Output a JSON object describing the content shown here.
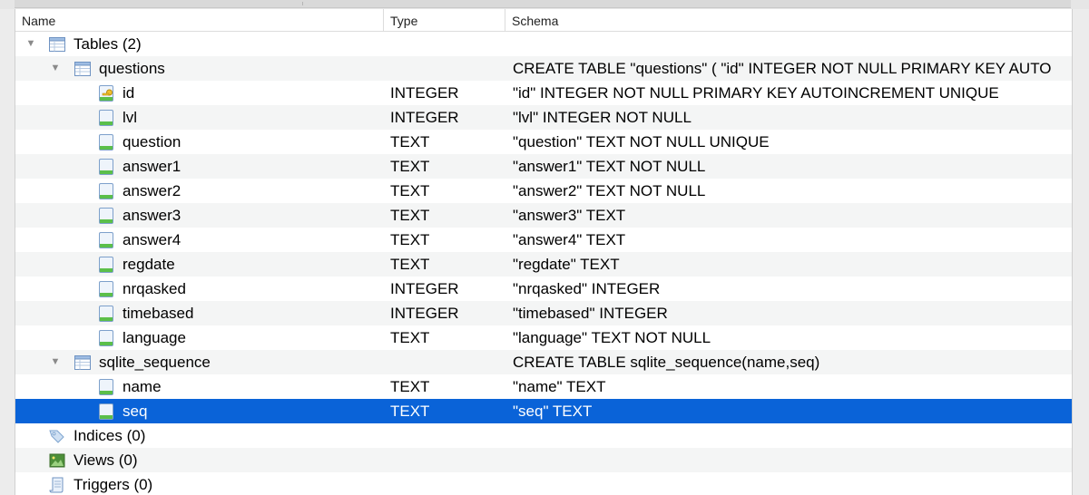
{
  "columns": {
    "name": "Name",
    "type": "Type",
    "schema": "Schema"
  },
  "rows": [
    {
      "label": "Tables (2)",
      "type": "",
      "schema": "",
      "level": 0,
      "icon": "table-group-icon",
      "disclosure": true
    },
    {
      "label": "questions",
      "type": "",
      "schema": "CREATE TABLE \"questions\" ( \"id\" INTEGER NOT NULL PRIMARY KEY AUTO",
      "level": 1,
      "icon": "table-icon",
      "disclosure": true
    },
    {
      "label": "id",
      "type": "INTEGER",
      "schema": "\"id\" INTEGER NOT NULL PRIMARY KEY AUTOINCREMENT UNIQUE",
      "level": 2,
      "icon": "primary-key-field-icon"
    },
    {
      "label": "lvl",
      "type": "INTEGER",
      "schema": "\"lvl\" INTEGER NOT NULL",
      "level": 2,
      "icon": "field-icon"
    },
    {
      "label": "question",
      "type": "TEXT",
      "schema": "\"question\" TEXT NOT NULL UNIQUE",
      "level": 2,
      "icon": "field-icon"
    },
    {
      "label": "answer1",
      "type": "TEXT",
      "schema": "\"answer1\" TEXT NOT NULL",
      "level": 2,
      "icon": "field-icon"
    },
    {
      "label": "answer2",
      "type": "TEXT",
      "schema": "\"answer2\" TEXT NOT NULL",
      "level": 2,
      "icon": "field-icon"
    },
    {
      "label": "answer3",
      "type": "TEXT",
      "schema": "\"answer3\" TEXT",
      "level": 2,
      "icon": "field-icon"
    },
    {
      "label": "answer4",
      "type": "TEXT",
      "schema": "\"answer4\" TEXT",
      "level": 2,
      "icon": "field-icon"
    },
    {
      "label": "regdate",
      "type": "TEXT",
      "schema": "\"regdate\" TEXT",
      "level": 2,
      "icon": "field-icon"
    },
    {
      "label": "nrqasked",
      "type": "INTEGER",
      "schema": "\"nrqasked\" INTEGER",
      "level": 2,
      "icon": "field-icon"
    },
    {
      "label": "timebased",
      "type": "INTEGER",
      "schema": "\"timebased\" INTEGER",
      "level": 2,
      "icon": "field-icon"
    },
    {
      "label": "language",
      "type": "TEXT",
      "schema": "\"language\" TEXT NOT NULL",
      "level": 2,
      "icon": "field-icon"
    },
    {
      "label": "sqlite_sequence",
      "type": "",
      "schema": "CREATE TABLE sqlite_sequence(name,seq)",
      "level": 1,
      "icon": "table-icon",
      "disclosure": true
    },
    {
      "label": "name",
      "type": "TEXT",
      "schema": "\"name\" TEXT",
      "level": 2,
      "icon": "field-icon"
    },
    {
      "label": "seq",
      "type": "TEXT",
      "schema": "\"seq\" TEXT",
      "level": 2,
      "icon": "field-icon",
      "selected": true
    },
    {
      "label": "Indices (0)",
      "type": "",
      "schema": "",
      "level": 0,
      "icon": "index-tag-icon"
    },
    {
      "label": "Views (0)",
      "type": "",
      "schema": "",
      "level": 0,
      "icon": "view-image-icon"
    },
    {
      "label": "Triggers (0)",
      "type": "",
      "schema": "",
      "level": 0,
      "icon": "trigger-script-icon"
    }
  ],
  "colors": {
    "selection": "#0a63d8",
    "alt_row": "#f4f5f5",
    "header_border": "#dcdcdc"
  }
}
